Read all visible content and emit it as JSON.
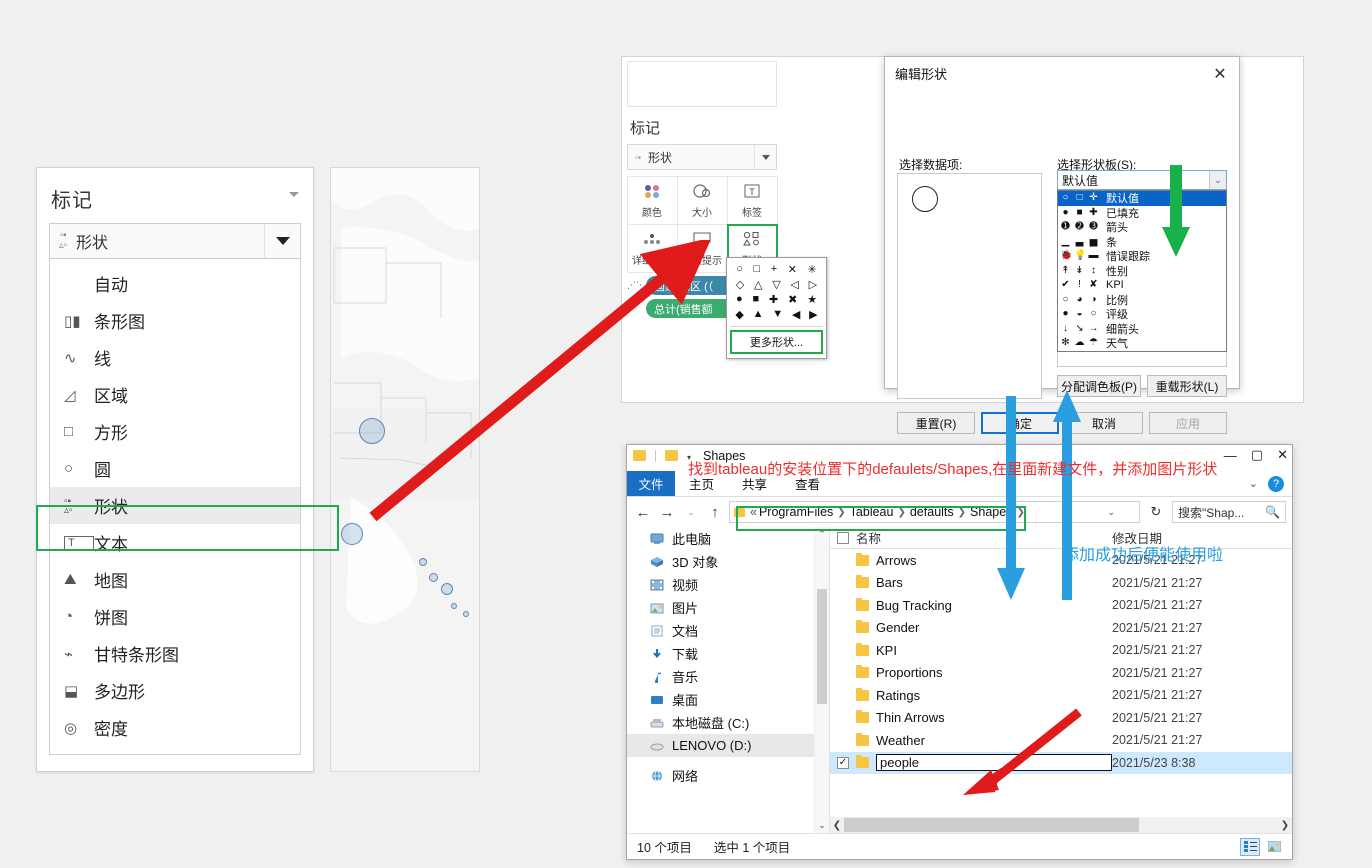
{
  "left_panel": {
    "title": "标记",
    "select": {
      "icon": "shapes-icon",
      "value": "形状"
    },
    "menu_items": [
      {
        "icon": "",
        "label": "自动"
      },
      {
        "icon": "▯▮",
        "label": "条形图"
      },
      {
        "icon": "∿",
        "label": "线"
      },
      {
        "icon": "◿",
        "label": "区域"
      },
      {
        "icon": "□",
        "label": "方形"
      },
      {
        "icon": "○",
        "label": "圆"
      },
      {
        "icon": "⬚",
        "label": "形状",
        "selected": true
      },
      {
        "icon": "T",
        "label": "文本"
      },
      {
        "icon": "⛰",
        "label": "地图"
      },
      {
        "icon": "◔",
        "label": "饼图"
      },
      {
        "icon": "⌁",
        "label": "甘特条形图"
      },
      {
        "icon": "⬓",
        "label": "多边形"
      },
      {
        "icon": "◎",
        "label": "密度"
      }
    ]
  },
  "tableau_panel": {
    "marks_title": "标记",
    "mark_type": {
      "value": "形状",
      "icon": "shapes-icon"
    },
    "buttons": [
      {
        "name": "color",
        "label": "颜色",
        "icon": "color-dots-icon"
      },
      {
        "name": "size",
        "label": "大小",
        "icon": "size-icon"
      },
      {
        "name": "label",
        "label": "标签",
        "icon": "label-text-icon"
      },
      {
        "name": "detail",
        "label": "详细信息",
        "icon": "detail-dots-icon"
      },
      {
        "name": "tooltip",
        "label": "工具提示",
        "icon": "tooltip-icon"
      },
      {
        "name": "shape",
        "label": "形状",
        "icon": "shapes-icon",
        "highlighted": true
      }
    ],
    "pills": [
      {
        "label": "国家/地区 (（",
        "color": "#3d87a8",
        "icon": "detail-dots-icon"
      },
      {
        "label": "总计(销售额",
        "color": "#3bab70",
        "icon": "size-icon"
      }
    ]
  },
  "shape_flyout": {
    "rows": [
      [
        "○",
        "□",
        "+",
        "✕",
        "✳"
      ],
      [
        "◇",
        "△",
        "▽",
        "◁",
        "▷"
      ],
      [
        "●",
        "■",
        "✚",
        "✖",
        "★"
      ],
      [
        "◆",
        "▲",
        "▼",
        "◀",
        "▶"
      ]
    ],
    "more_label": "更多形状..."
  },
  "dialog": {
    "title": "编辑形状",
    "close_icon": "close-icon",
    "label_data_items": "选择数据项:",
    "label_shape_palette": "选择形状板(S):",
    "combo_value": "默认值",
    "palette_options": [
      {
        "glyphs": [
          "○",
          "□",
          "✛"
        ],
        "label": "默认值",
        "selected": true
      },
      {
        "glyphs": [
          "●",
          "■",
          "✚"
        ],
        "label": "已填充"
      },
      {
        "glyphs": [
          "➊",
          "➋",
          "➌"
        ],
        "label": "箭头"
      },
      {
        "glyphs": [
          "▁",
          "▃",
          "▅"
        ],
        "label": "条"
      },
      {
        "glyphs": [
          "🐞",
          "💡",
          "▬"
        ],
        "label": "惜误跟踪"
      },
      {
        "glyphs": [
          "↟",
          "↡",
          "↕"
        ],
        "label": "性别"
      },
      {
        "glyphs": [
          "✔",
          "!",
          "✘"
        ],
        "label": "KPI"
      },
      {
        "glyphs": [
          "○",
          "◕",
          "◑"
        ],
        "label": "比例"
      },
      {
        "glyphs": [
          "●",
          "◒",
          "○"
        ],
        "label": "评级"
      },
      {
        "glyphs": [
          "↓",
          "↘",
          "→"
        ],
        "label": "细箭头"
      },
      {
        "glyphs": [
          "✻",
          "☁",
          "☂"
        ],
        "label": "天气"
      }
    ],
    "buttons": {
      "assign_palette": "分配调色板(P)",
      "reload_shapes": "重载形状(L)",
      "reset": "重置(R)",
      "ok": "确定",
      "cancel": "取消",
      "apply": "应用"
    }
  },
  "explorer": {
    "title": "Shapes",
    "quick_access_icons": [
      "folder-icon",
      "folder-icon",
      "chevron-down-icon"
    ],
    "window_buttons": [
      "minimize-icon",
      "maximize-icon",
      "close-icon"
    ],
    "ribbon_tabs": [
      {
        "label": "文件",
        "active": true
      },
      {
        "label": "主页"
      },
      {
        "label": "共享"
      },
      {
        "label": "查看"
      }
    ],
    "help_icon": "help-icon",
    "nav": {
      "back_icon": "arrow-left-icon",
      "forward_icon": "arrow-right-icon",
      "recent_icon": "chevron-down-icon",
      "up_icon": "arrow-up-icon",
      "refresh_icon": "refresh-icon"
    },
    "breadcrumb": [
      "ProgramFiles",
      "Tableau",
      "defaults",
      "Shapes"
    ],
    "breadcrumb_prefix": "«",
    "search_placeholder": "搜索\"Shap...",
    "search_icon": "search-icon",
    "tree_items": [
      {
        "label": "此电脑",
        "icon": "computer-icon"
      },
      {
        "label": "3D 对象",
        "icon": "3d-object-icon"
      },
      {
        "label": "视频",
        "icon": "video-icon"
      },
      {
        "label": "图片",
        "icon": "picture-icon"
      },
      {
        "label": "文档",
        "icon": "document-icon"
      },
      {
        "label": "下载",
        "icon": "download-icon"
      },
      {
        "label": "音乐",
        "icon": "music-icon"
      },
      {
        "label": "桌面",
        "icon": "desktop-icon"
      },
      {
        "label": "本地磁盘 (C:)",
        "icon": "disk-icon"
      },
      {
        "label": "LENOVO (D:)",
        "icon": "disk-icon",
        "selected": true
      },
      {
        "label": "网络",
        "icon": "network-icon"
      }
    ],
    "columns": {
      "name": "名称",
      "date": "修改日期"
    },
    "files": [
      {
        "name": "Arrows",
        "date": "2021/5/21 21:27"
      },
      {
        "name": "Bars",
        "date": "2021/5/21 21:27"
      },
      {
        "name": "Bug Tracking",
        "date": "2021/5/21 21:27"
      },
      {
        "name": "Gender",
        "date": "2021/5/21 21:27"
      },
      {
        "name": "KPI",
        "date": "2021/5/21 21:27"
      },
      {
        "name": "Proportions",
        "date": "2021/5/21 21:27"
      },
      {
        "name": "Ratings",
        "date": "2021/5/21 21:27"
      },
      {
        "name": "Thin Arrows",
        "date": "2021/5/21 21:27"
      },
      {
        "name": "Weather",
        "date": "2021/5/21 21:27"
      },
      {
        "name": "people",
        "date": "2021/5/23 8:38",
        "selected": true,
        "checked": true,
        "editing": true
      }
    ],
    "status": {
      "items": "10 个项目",
      "selected": "选中 1 个项目"
    },
    "view_buttons": [
      "details-view-icon",
      "large-icons-view-icon"
    ]
  },
  "annotations": {
    "red_note": "找到tableau的安装位置下的defaulets/Shapes,在里面新建文件，并添加图片形状",
    "blue_note": "添加成功后便能使用啦",
    "colors": {
      "red_arrow": "#e01b1b",
      "blue_arrow": "#2a9ede",
      "green_arrow": "#1faa4e",
      "green_box": "#1faa4e",
      "red_text": "#ef2b2b",
      "blue_text": "#2a9ede",
      "accent_blue": "#0a64c8"
    }
  }
}
